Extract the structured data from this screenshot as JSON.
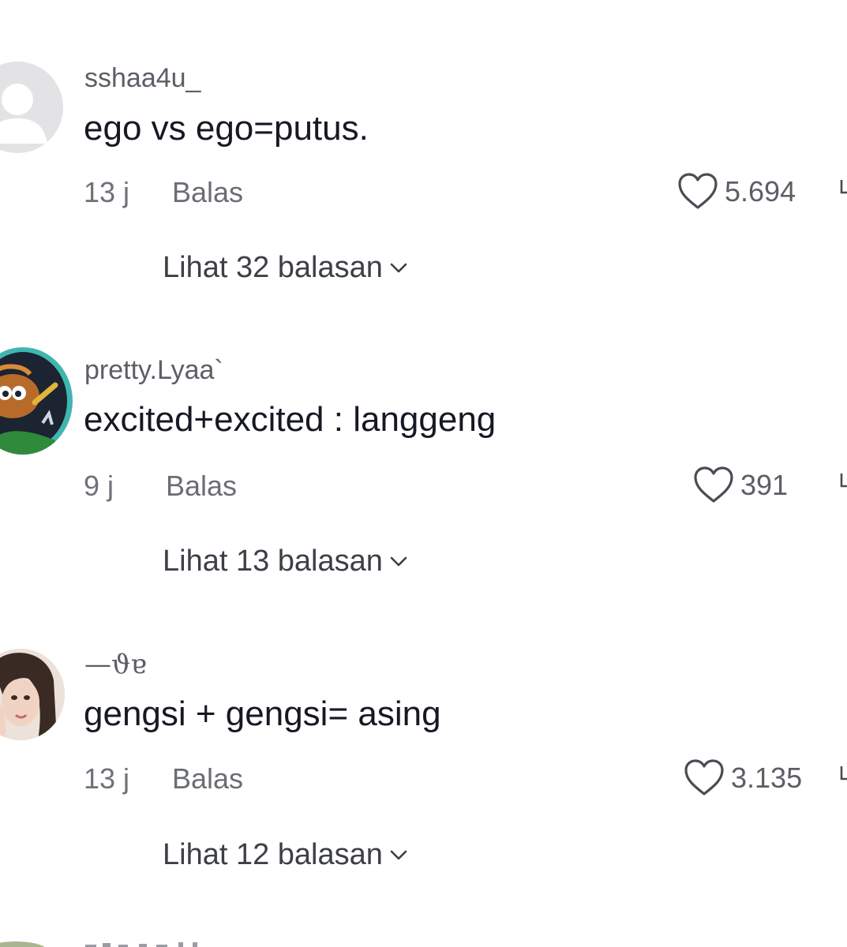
{
  "comments": [
    {
      "username": "sshaa4u_",
      "text": "ego vs ego=putus.",
      "time": "13 j",
      "reply_label": "Balas",
      "likes": "5.694",
      "view_replies": "Lihat 32 balasan",
      "avatar": "default-avatar"
    },
    {
      "username": "pretty.Lyaa`",
      "text": "excited+excited : langgeng",
      "time": "9 j",
      "reply_label": "Balas",
      "likes": "391",
      "view_replies": "Lihat 13 balasan",
      "avatar": "cartoon-avatar"
    },
    {
      "username": "—ϑɐ",
      "text": "gengsi + gengsi= asing",
      "time": "13 j",
      "reply_label": "Balas",
      "likes": "3.135",
      "view_replies": "Lihat 12 balasan",
      "avatar": "photo-avatar"
    }
  ],
  "icons": {
    "like": "heart-outline-icon",
    "dislike": "thumbs-down-icon",
    "expand": "chevron-down-icon"
  },
  "colors": {
    "text_primary": "#161823",
    "text_secondary": "#5c5e66",
    "avatar_default": "#e3e3e6",
    "story_ring": "#3fb6b0"
  }
}
